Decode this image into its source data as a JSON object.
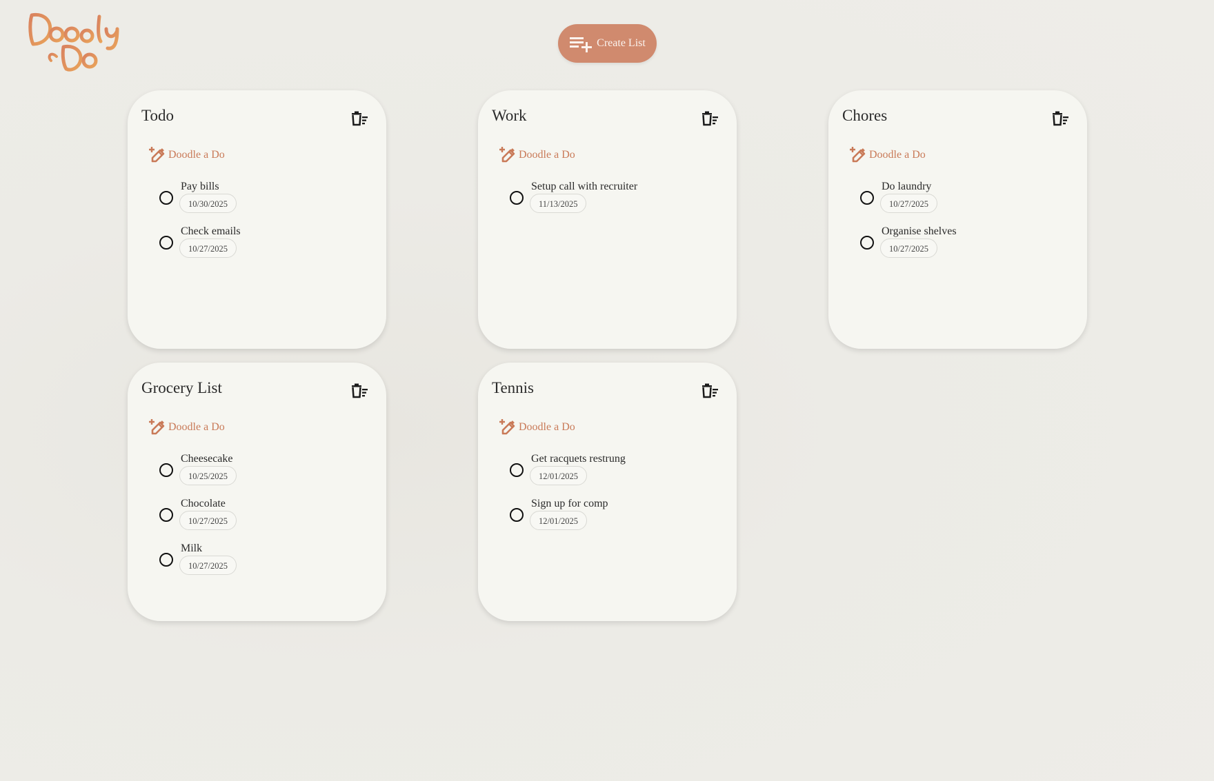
{
  "app": {
    "logo_text": "Doodly Do",
    "create_list_label": "Create List"
  },
  "colors": {
    "accent": "#d08a6e",
    "accent_text": "#c97a58",
    "card_bg": "#f6f6f1",
    "page_bg": "#eeede8"
  },
  "lists": [
    {
      "title": "Todo",
      "add_label": "Doodle a Do",
      "items": [
        {
          "label": "Pay bills",
          "date": "10/30/2025"
        },
        {
          "label": "Check emails",
          "date": "10/27/2025"
        }
      ]
    },
    {
      "title": "Work",
      "add_label": "Doodle a Do",
      "items": [
        {
          "label": "Setup call with recruiter",
          "date": "11/13/2025"
        }
      ]
    },
    {
      "title": "Chores",
      "add_label": "Doodle a Do",
      "items": [
        {
          "label": "Do laundry",
          "date": "10/27/2025"
        },
        {
          "label": "Organise shelves",
          "date": "10/27/2025"
        }
      ]
    },
    {
      "title": "Grocery List",
      "add_label": "Doodle a Do",
      "items": [
        {
          "label": "Cheesecake",
          "date": "10/25/2025"
        },
        {
          "label": "Chocolate",
          "date": "10/27/2025"
        },
        {
          "label": "Milk",
          "date": "10/27/2025"
        }
      ]
    },
    {
      "title": "Tennis",
      "add_label": "Doodle a Do",
      "items": [
        {
          "label": "Get racquets restrung",
          "date": "12/01/2025"
        },
        {
          "label": "Sign up for comp",
          "date": "12/01/2025"
        }
      ]
    }
  ]
}
